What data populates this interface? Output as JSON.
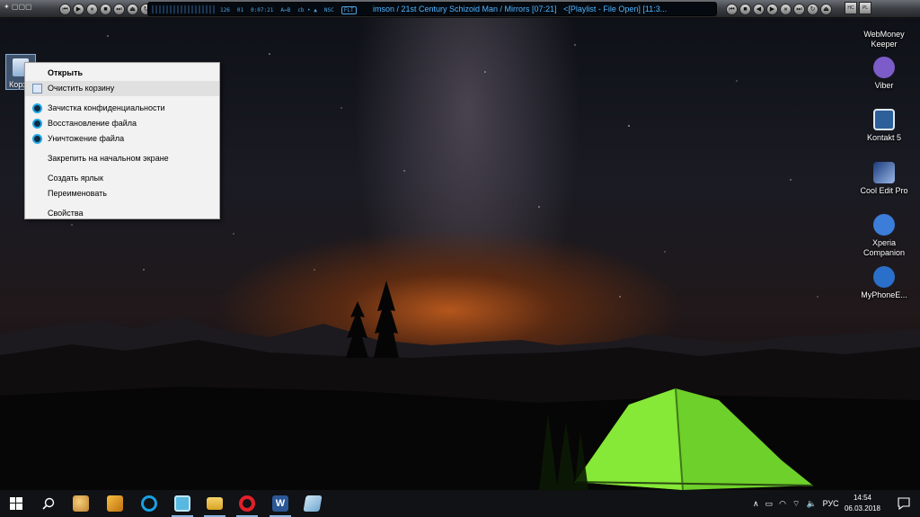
{
  "player": {
    "logo": "✦ ▢▢▢",
    "stats": {
      "bitrate": "126",
      "khz": "01",
      "time": "0:07:21",
      "mode": "A↔B",
      "mode2": "cb • ▲",
      "nsc": "NSC",
      "flt": "FLT"
    },
    "track_title": "imson / 21st Century Schizoid Man / Mirrors  [07:21]",
    "playlist_status": "<[Playlist - File Open]  [11:3...",
    "right_buttons": [
      "HC",
      "PL"
    ]
  },
  "desktop": {
    "recycle_bin_label": "Корз",
    "icons": [
      {
        "name": "webmoney-keeper",
        "label": "WebMoney Keeper",
        "color": "#5b8fd6"
      },
      {
        "name": "viber",
        "label": "Viber",
        "color": "#7c5cc8"
      },
      {
        "name": "kontakt",
        "label": "Kontakt 5",
        "color": "#2d5f9a"
      },
      {
        "name": "cool-edit-pro",
        "label": "Cool Edit Pro",
        "color": "#1a3a7a"
      },
      {
        "name": "xperia-companion",
        "label": "Xperia Companion",
        "color": "#3b7dd8"
      },
      {
        "name": "myphoneexplorer",
        "label": "MyPhoneE...",
        "color": "#2a6fc9"
      }
    ]
  },
  "context_menu": {
    "open": "Открыть",
    "empty": "Очистить корзину",
    "privacy": "Зачистка конфиденциальности",
    "restore": "Восстановление файла",
    "shred": "Уничтожение файла",
    "pin": "Закрепить на начальном экране",
    "shortcut": "Создать ярлык",
    "rename": "Переименовать",
    "properties": "Свойства"
  },
  "taskbar": {
    "apps": [
      {
        "name": "paint-icon",
        "color": "#e0a040"
      },
      {
        "name": "fl-studio-icon",
        "color": "#e8a020"
      },
      {
        "name": "ccleaner-icon",
        "color": "#1aa0e0"
      },
      {
        "name": "app-icon",
        "color": "#58b8e0"
      },
      {
        "name": "file-explorer-icon",
        "color": "#f0c040"
      },
      {
        "name": "opera-icon",
        "color": "#e0202a"
      },
      {
        "name": "word-icon",
        "color": "#2b5797"
      },
      {
        "name": "notepad-icon",
        "color": "#8fc0e0"
      }
    ],
    "language": "РУС",
    "time": "14:54",
    "date": "06.03.2018"
  }
}
